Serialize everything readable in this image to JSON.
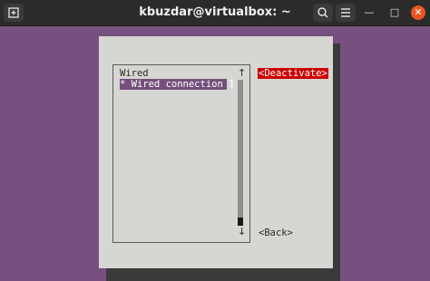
{
  "window": {
    "title": "kbuzdar@virtualbox: ~",
    "new_tab_icon": "new-tab-icon",
    "search_icon": "search-icon",
    "menu_icon": "hamburger-menu-icon",
    "minimize_glyph": "—",
    "maximize_glyph": "□",
    "close_glyph": "✕"
  },
  "nmtui": {
    "section_label": "Wired",
    "connections": [
      "* Wired connection 1"
    ],
    "scroll_up": "↑",
    "scroll_down": "↓",
    "deactivate_label": "<Deactivate>",
    "back_label": "<Back>"
  },
  "colors": {
    "terminal_bg": "#77507f",
    "dialog_bg": "#d6d6d3",
    "selected_row": "#75507b",
    "deactivate_bg": "#cc0000",
    "close_button": "#e95420"
  }
}
